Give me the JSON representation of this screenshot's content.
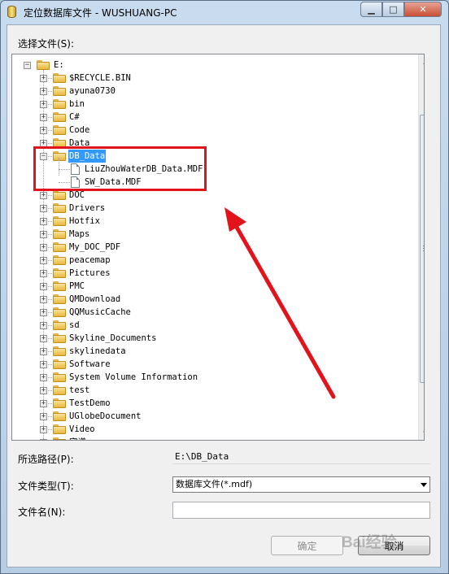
{
  "window": {
    "title": "定位数据库文件 - WUSHUANG-PC",
    "min_glyph": "▁",
    "max_glyph": "□",
    "close_glyph": "✕"
  },
  "labels": {
    "select_file": "选择文件(S):",
    "selected_path": "所选路径(P):",
    "file_type": "文件类型(T):",
    "file_name": "文件名(N):"
  },
  "tree": {
    "root": {
      "label": "E:",
      "expander": "−"
    },
    "items": [
      {
        "label": "$RECYCLE.BIN",
        "type": "folder",
        "expander": "+"
      },
      {
        "label": "ayuna0730",
        "type": "folder",
        "expander": "+"
      },
      {
        "label": "bin",
        "type": "folder",
        "expander": "+"
      },
      {
        "label": "C#",
        "type": "folder",
        "expander": "+"
      },
      {
        "label": "Code",
        "type": "folder",
        "expander": "+"
      },
      {
        "label": "Data",
        "type": "folder",
        "expander": "+"
      },
      {
        "label": "DB_Data",
        "type": "folder",
        "expander": "−",
        "selected": true
      },
      {
        "label": "LiuZhouWaterDB_Data.MDF",
        "type": "file",
        "child": true
      },
      {
        "label": "SW_Data.MDF",
        "type": "file",
        "child": true
      },
      {
        "label": "DOC",
        "type": "folder",
        "expander": "+"
      },
      {
        "label": "Drivers",
        "type": "folder",
        "expander": "+"
      },
      {
        "label": "Hotfix",
        "type": "folder",
        "expander": "+"
      },
      {
        "label": "Maps",
        "type": "folder",
        "expander": "+"
      },
      {
        "label": "My_DOC_PDF",
        "type": "folder",
        "expander": "+"
      },
      {
        "label": "peacemap",
        "type": "folder",
        "expander": "+"
      },
      {
        "label": "Pictures",
        "type": "folder",
        "expander": "+"
      },
      {
        "label": "PMC",
        "type": "folder",
        "expander": "+"
      },
      {
        "label": "QMDownload",
        "type": "folder",
        "expander": "+"
      },
      {
        "label": "QQMusicCache",
        "type": "folder",
        "expander": "+"
      },
      {
        "label": "sd",
        "type": "folder",
        "expander": "+"
      },
      {
        "label": "Skyline_Documents",
        "type": "folder",
        "expander": "+"
      },
      {
        "label": "skylinedata",
        "type": "folder",
        "expander": "+"
      },
      {
        "label": "Software",
        "type": "folder",
        "expander": "+"
      },
      {
        "label": "System Volume Information",
        "type": "folder",
        "expander": "+"
      },
      {
        "label": "test",
        "type": "folder",
        "expander": "+"
      },
      {
        "label": "TestDemo",
        "type": "folder",
        "expander": "+"
      },
      {
        "label": "UGlobeDocument",
        "type": "folder",
        "expander": "+"
      },
      {
        "label": "Video",
        "type": "folder",
        "expander": "+"
      },
      {
        "label": "宾谱",
        "type": "folder",
        "expander": "+"
      }
    ]
  },
  "scrollbar": {
    "up_glyph": "▲",
    "down_glyph": "▼"
  },
  "fields": {
    "selected_path_value": "E:\\DB_Data",
    "file_type_value": "数据库文件(*.mdf)",
    "file_name_value": ""
  },
  "buttons": {
    "ok": "确定",
    "cancel": "取消"
  },
  "watermark": "Bai经验",
  "colors": {
    "selection": "#3399ff",
    "annotation": "#e3131b",
    "title_bar": "#b9d1ea"
  }
}
